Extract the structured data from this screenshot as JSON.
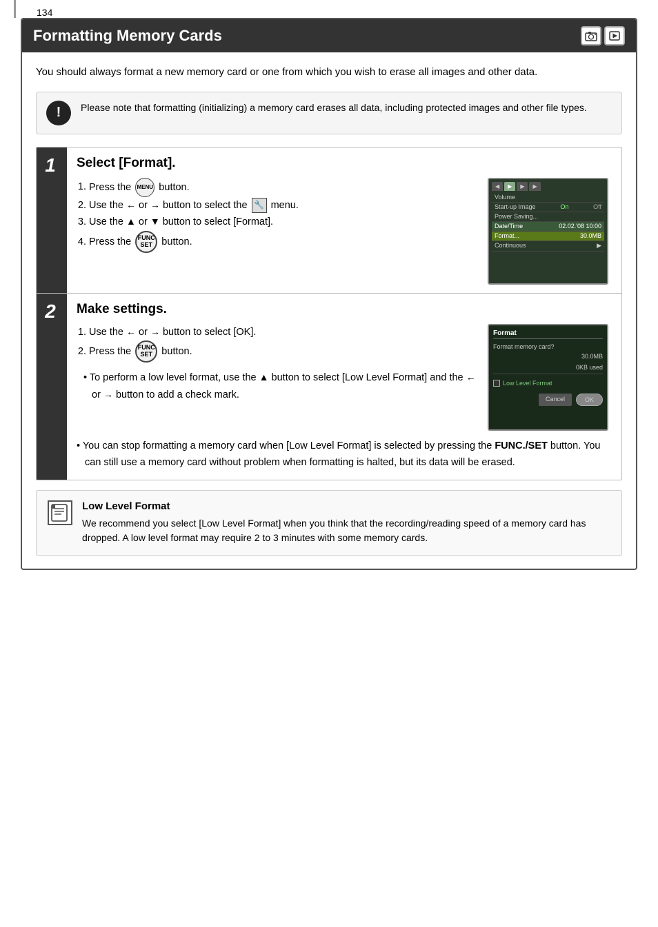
{
  "page": {
    "number": "134",
    "title": "Formatting Memory Cards",
    "intro": "You should always format a new memory card or one from which you wish to erase all images and other data.",
    "warning": {
      "text": "Please note that formatting (initializing) a memory card erases all data, including protected images and other file types."
    },
    "steps": [
      {
        "number": "1",
        "heading": "Select [Format].",
        "instructions": [
          "Press the  button.",
          "Use the ← or → button to select the  menu.",
          "Use the ▲ or ▼ button to select [Format].",
          "Press the  button."
        ]
      },
      {
        "number": "2",
        "heading": "Make settings.",
        "instructions": [
          "Use the ← or → button to select [OK].",
          "Press the  button."
        ],
        "bullets": [
          "To perform a low level format, use the ▲ button to select [Low Level Format] and the ← or → button to add a check mark.",
          "You can stop formatting a memory card when [Low Level Format] is selected by pressing the FUNC./SET button. You can still use a memory card without problem when formatting is halted, but its data will be erased."
        ]
      }
    ],
    "note": {
      "title": "Low Level Format",
      "text": "We recommend you select [Low Level Format] when you think that the recording/reading speed of a memory card has dropped. A low level format may require 2 to 3 minutes with some memory cards."
    },
    "camera_screen": {
      "tabs": [
        "◀",
        "▶",
        "▶",
        "▶"
      ],
      "active_tab": 1,
      "items": [
        {
          "label": "Volume",
          "value": ""
        },
        {
          "label": "Start-up Image",
          "value": "On  Off"
        },
        {
          "label": "Power Saving...",
          "value": ""
        },
        {
          "label": "Date/Time",
          "value": "02. 02. '08  10:00",
          "highlighted": true
        },
        {
          "label": "Format...",
          "value": "30.0MB",
          "selected": true
        },
        {
          "label": "Continuous",
          "value": "▶"
        }
      ]
    },
    "format_screen": {
      "title": "Format",
      "question": "Format memory card?",
      "size": "30.0MB",
      "used": "0KB used",
      "low_level_label": "Low Level Format",
      "cancel_label": "Cancel",
      "ok_label": "OK"
    },
    "mode_icons": [
      "📷",
      "▶"
    ]
  }
}
